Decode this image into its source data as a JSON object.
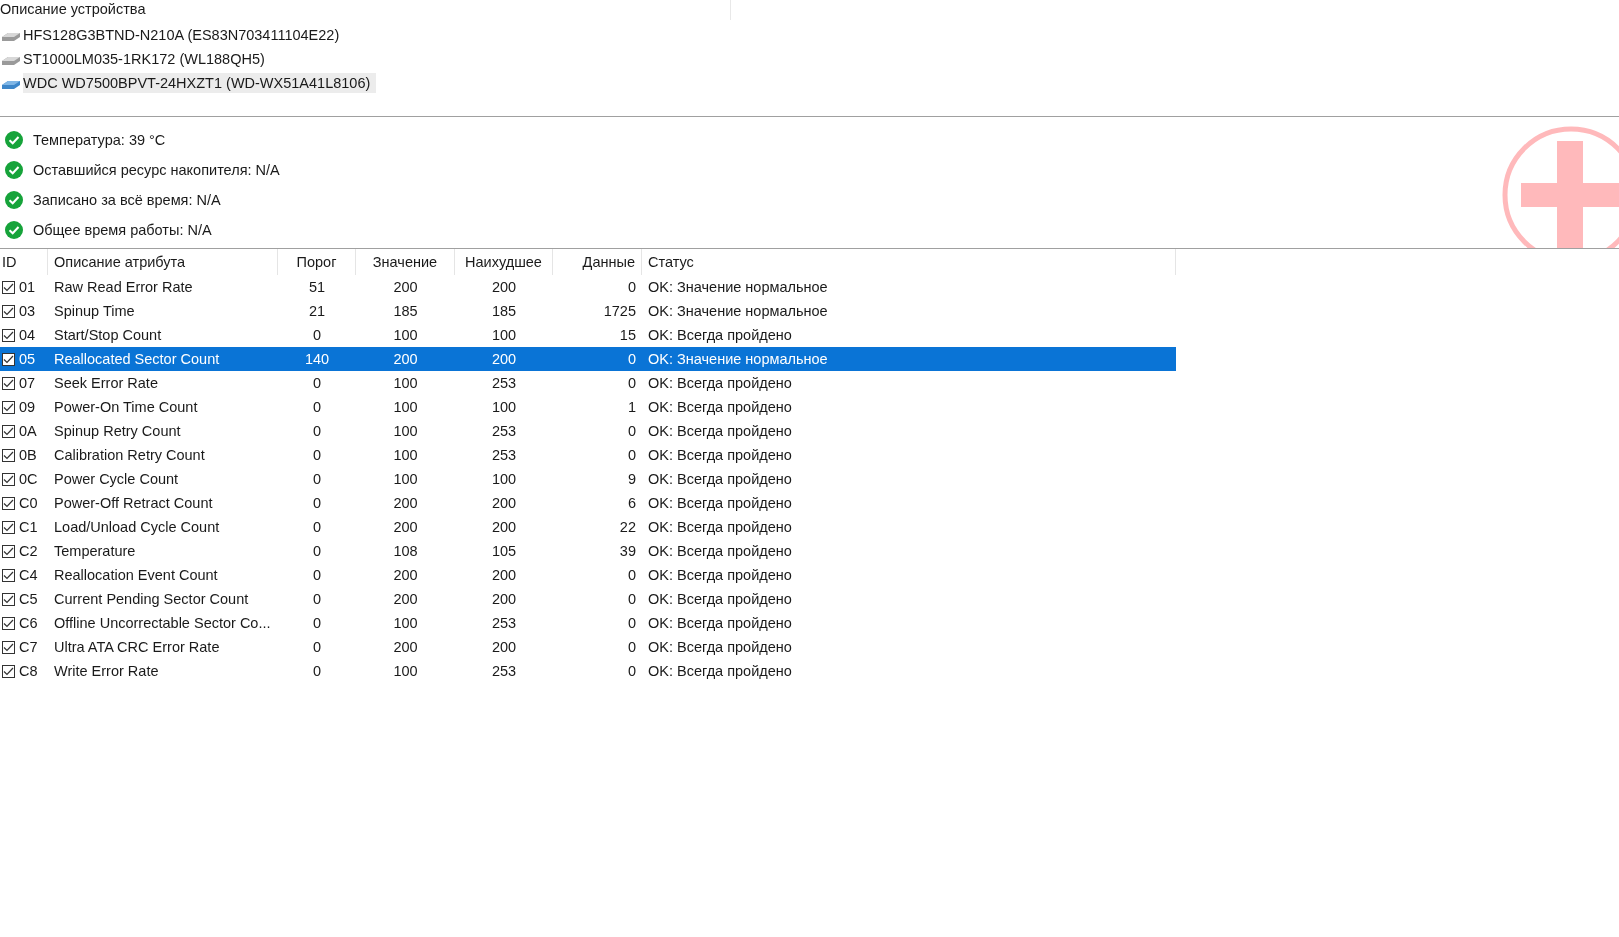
{
  "devices": {
    "header": "Описание устройства",
    "items": [
      {
        "label": "HFS128G3BTND-N210A (ES83N703411104E22)",
        "selected": false
      },
      {
        "label": "ST1000LM035-1RK172 (WL188QH5)",
        "selected": false
      },
      {
        "label": "WDC WD7500BPVT-24HXZT1 (WD-WX51A41L8106)",
        "selected": true
      }
    ]
  },
  "summary": [
    {
      "label": "Температура: 39 °C",
      "kind": "ok"
    },
    {
      "label": "Оставшийся ресурс накопителя: N/A",
      "kind": "ok"
    },
    {
      "label": "Записано за всё время: N/A",
      "kind": "ok"
    },
    {
      "label": "Общее время работы: N/A",
      "kind": "ok"
    }
  ],
  "health_badge": {
    "kind": "cross"
  },
  "table": {
    "columns": [
      "ID",
      "Описание атрибута",
      "Порог",
      "Значение",
      "Наихудшее",
      "Данные",
      "Статус"
    ],
    "rows": [
      {
        "checked": true,
        "selected": false,
        "cells": [
          "01",
          "Raw Read Error Rate",
          "51",
          "200",
          "200",
          "0",
          "OK: Значение нормальное"
        ]
      },
      {
        "checked": true,
        "selected": false,
        "cells": [
          "03",
          "Spinup Time",
          "21",
          "185",
          "185",
          "1725",
          "OK: Значение нормальное"
        ]
      },
      {
        "checked": true,
        "selected": false,
        "cells": [
          "04",
          "Start/Stop Count",
          "0",
          "100",
          "100",
          "15",
          "OK: Всегда пройдено"
        ]
      },
      {
        "checked": true,
        "selected": true,
        "cells": [
          "05",
          "Reallocated Sector Count",
          "140",
          "200",
          "200",
          "0",
          "OK: Значение нормальное"
        ]
      },
      {
        "checked": true,
        "selected": false,
        "cells": [
          "07",
          "Seek Error Rate",
          "0",
          "100",
          "253",
          "0",
          "OK: Всегда пройдено"
        ]
      },
      {
        "checked": true,
        "selected": false,
        "cells": [
          "09",
          "Power-On Time Count",
          "0",
          "100",
          "100",
          "1",
          "OK: Всегда пройдено"
        ]
      },
      {
        "checked": true,
        "selected": false,
        "cells": [
          "0A",
          "Spinup Retry Count",
          "0",
          "100",
          "253",
          "0",
          "OK: Всегда пройдено"
        ]
      },
      {
        "checked": true,
        "selected": false,
        "cells": [
          "0B",
          "Calibration Retry Count",
          "0",
          "100",
          "253",
          "0",
          "OK: Всегда пройдено"
        ]
      },
      {
        "checked": true,
        "selected": false,
        "cells": [
          "0C",
          "Power Cycle Count",
          "0",
          "100",
          "100",
          "9",
          "OK: Всегда пройдено"
        ]
      },
      {
        "checked": true,
        "selected": false,
        "cells": [
          "C0",
          "Power-Off Retract Count",
          "0",
          "200",
          "200",
          "6",
          "OK: Всегда пройдено"
        ]
      },
      {
        "checked": true,
        "selected": false,
        "cells": [
          "C1",
          "Load/Unload Cycle Count",
          "0",
          "200",
          "200",
          "22",
          "OK: Всегда пройдено"
        ]
      },
      {
        "checked": true,
        "selected": false,
        "cells": [
          "C2",
          "Temperature",
          "0",
          "108",
          "105",
          "39",
          "OK: Всегда пройдено"
        ]
      },
      {
        "checked": true,
        "selected": false,
        "cells": [
          "C4",
          "Reallocation Event Count",
          "0",
          "200",
          "200",
          "0",
          "OK: Всегда пройдено"
        ]
      },
      {
        "checked": true,
        "selected": false,
        "cells": [
          "C5",
          "Current Pending Sector Count",
          "0",
          "200",
          "200",
          "0",
          "OK: Всегда пройдено"
        ]
      },
      {
        "checked": true,
        "selected": false,
        "cells": [
          "C6",
          "Offline Uncorrectable Sector Co...",
          "0",
          "100",
          "253",
          "0",
          "OK: Всегда пройдено"
        ]
      },
      {
        "checked": true,
        "selected": false,
        "cells": [
          "C7",
          "Ultra ATA CRC Error Rate",
          "0",
          "200",
          "200",
          "0",
          "OK: Всегда пройдено"
        ]
      },
      {
        "checked": true,
        "selected": false,
        "cells": [
          "C8",
          "Write Error Rate",
          "0",
          "100",
          "253",
          "0",
          "OK: Всегда пройдено"
        ]
      }
    ]
  }
}
